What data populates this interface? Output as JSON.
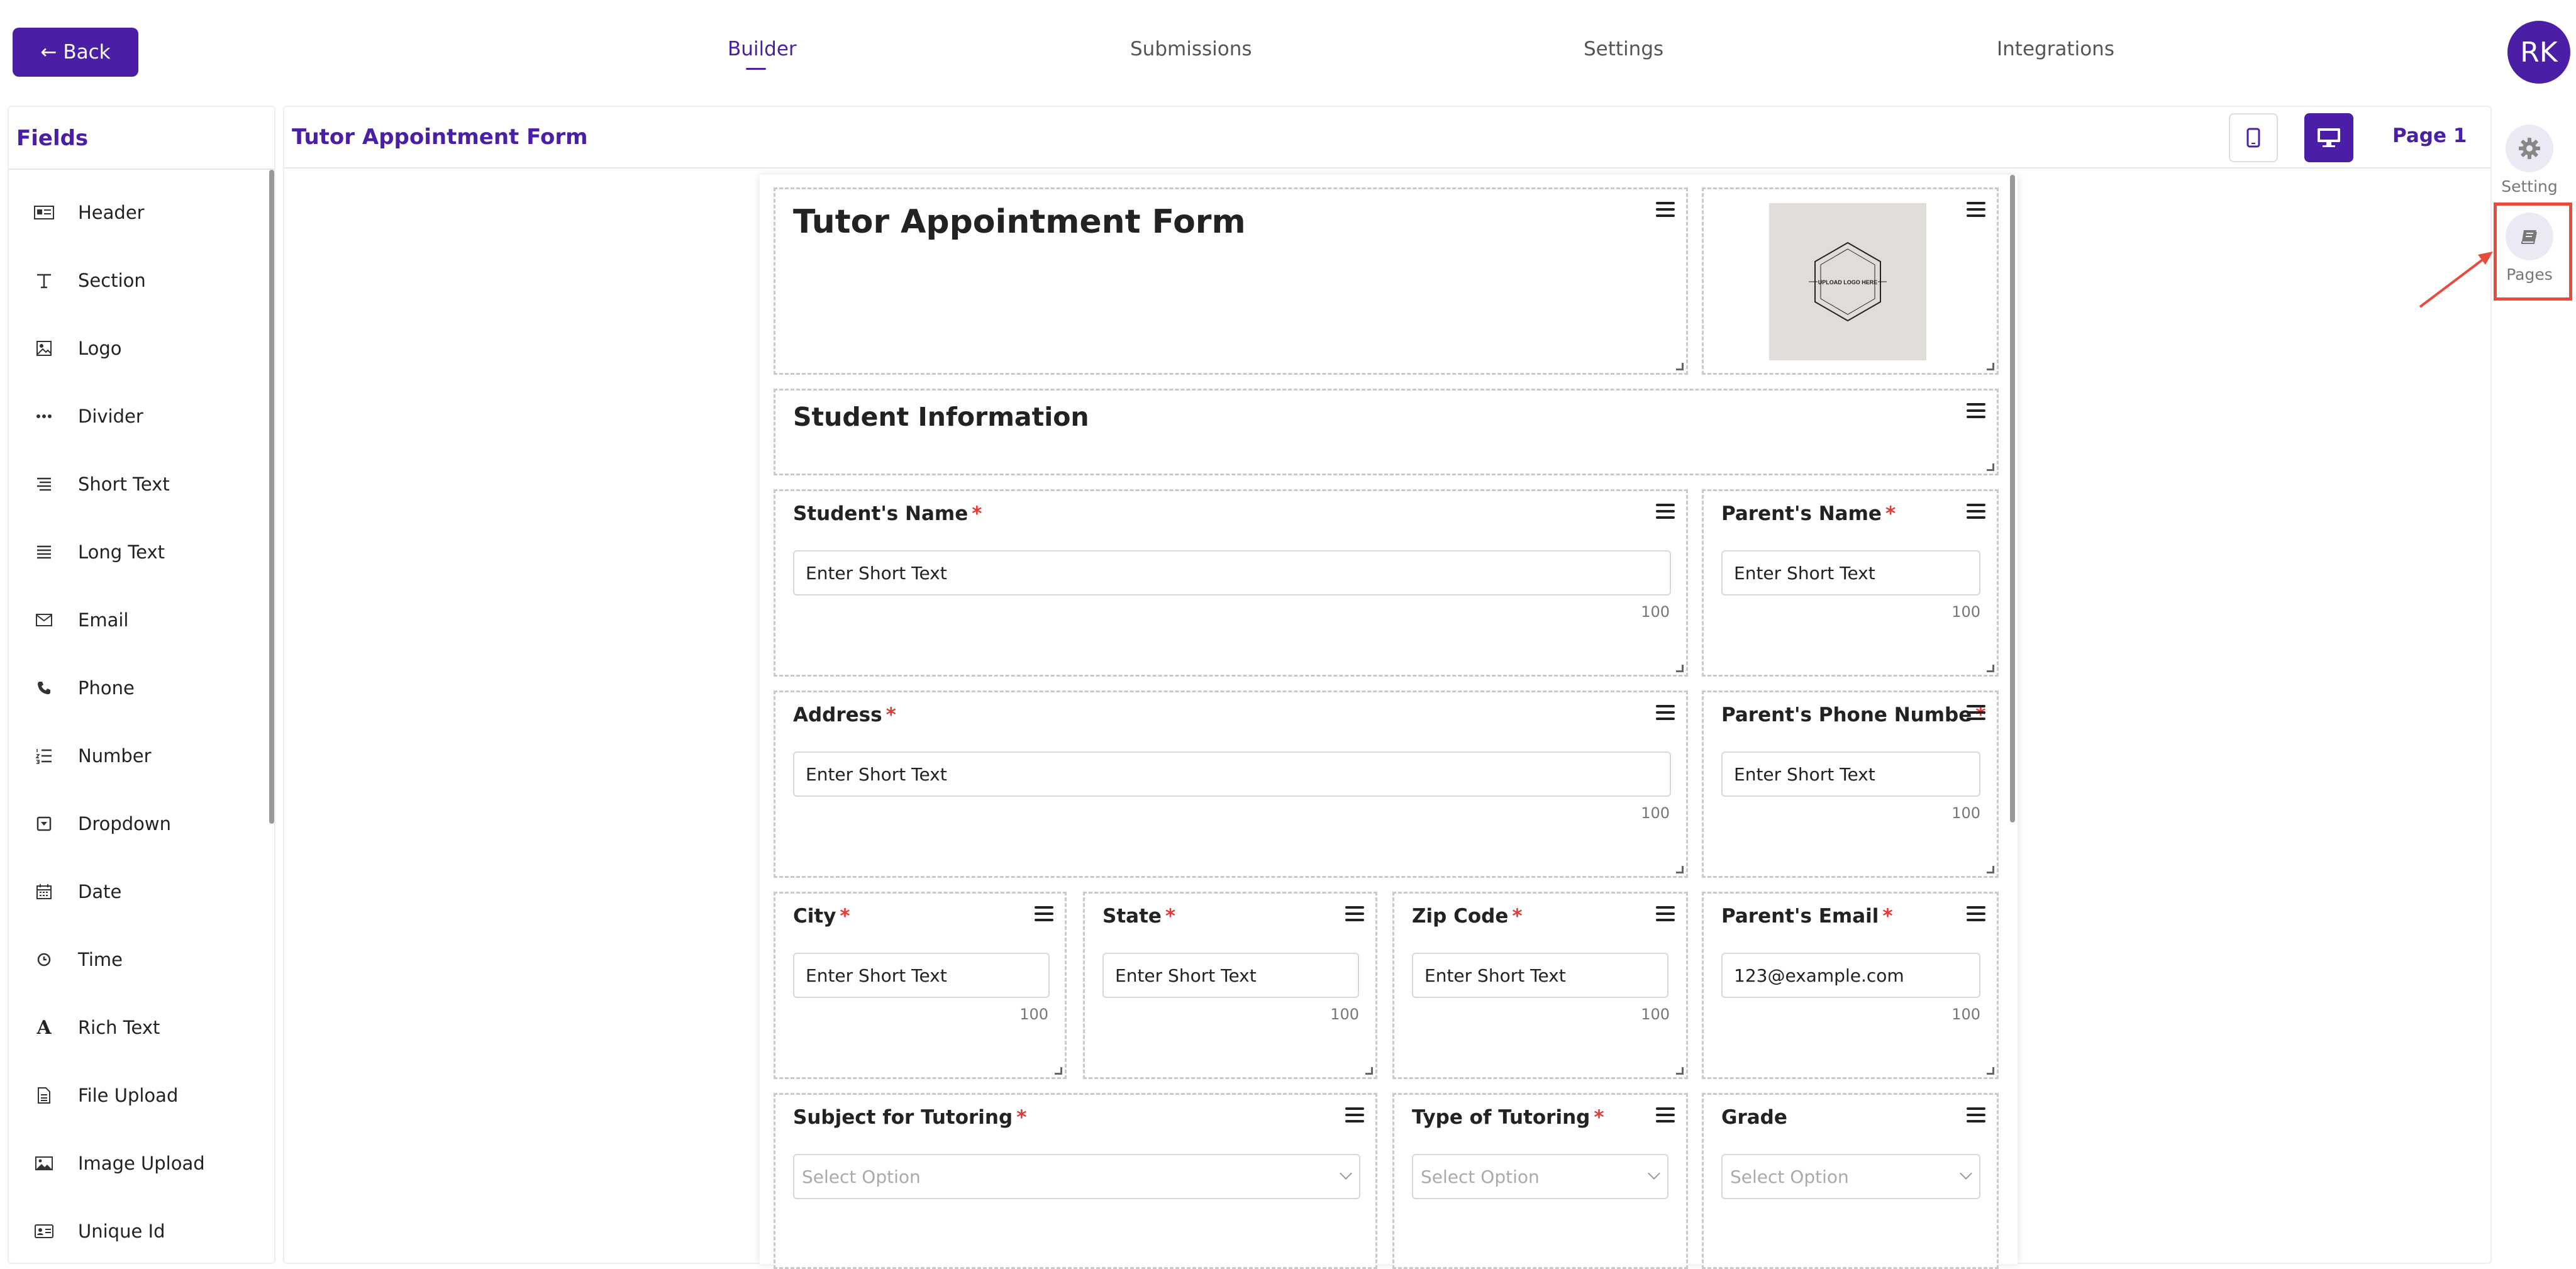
{
  "header": {
    "back_label": "Back",
    "tabs": [
      "Builder",
      "Submissions",
      "Settings",
      "Integrations"
    ],
    "active_tab": "Builder",
    "avatar_initials": "RK",
    "accent_color": "#4a1fa6"
  },
  "fields_panel": {
    "title": "Fields",
    "items": [
      {
        "label": "Header",
        "icon": "header-icon"
      },
      {
        "label": "Section",
        "icon": "text-icon"
      },
      {
        "label": "Logo",
        "icon": "image-icon"
      },
      {
        "label": "Divider",
        "icon": "dots-icon"
      },
      {
        "label": "Short Text",
        "icon": "short-text-icon"
      },
      {
        "label": "Long Text",
        "icon": "long-text-icon"
      },
      {
        "label": "Email",
        "icon": "envelope-icon"
      },
      {
        "label": "Phone",
        "icon": "phone-icon"
      },
      {
        "label": "Number",
        "icon": "numbered-list-icon"
      },
      {
        "label": "Dropdown",
        "icon": "dropdown-icon"
      },
      {
        "label": "Date",
        "icon": "calendar-icon"
      },
      {
        "label": "Time",
        "icon": "clock-icon"
      },
      {
        "label": "Rich Text",
        "icon": "rich-text-icon"
      },
      {
        "label": "File Upload",
        "icon": "file-icon"
      },
      {
        "label": "Image Upload",
        "icon": "image-upload-icon"
      },
      {
        "label": "Unique Id",
        "icon": "id-card-icon"
      }
    ]
  },
  "main": {
    "form_title": "Tutor Appointment Form",
    "page_label": "Page 1"
  },
  "form": {
    "title": "Tutor Appointment Form",
    "logo_text": "UPLOAD LOGO HERE",
    "section_title": "Student Information",
    "fields": {
      "student_name": {
        "label": "Student's Name",
        "placeholder": "Enter Short Text",
        "max": "100"
      },
      "parent_name": {
        "label": "Parent's Name",
        "placeholder": "Enter Short Text",
        "max": "100"
      },
      "address": {
        "label": "Address",
        "placeholder": "Enter Short Text",
        "max": "100"
      },
      "parent_phone": {
        "label": "Parent's Phone Numbe",
        "placeholder": "Enter Short Text",
        "max": "100"
      },
      "city": {
        "label": "City",
        "placeholder": "Enter Short Text",
        "max": "100"
      },
      "state": {
        "label": "State",
        "placeholder": "Enter Short Text",
        "max": "100"
      },
      "zip": {
        "label": "Zip Code",
        "placeholder": "Enter Short Text",
        "max": "100"
      },
      "parent_email": {
        "label": "Parent's Email",
        "placeholder": "123@example.com",
        "max": "100"
      },
      "subject": {
        "label": "Subject for Tutoring",
        "placeholder": "Select Option"
      },
      "tutoring_type": {
        "label": "Type of Tutoring",
        "placeholder": "Select Option"
      },
      "grade": {
        "label": "Grade",
        "placeholder": "Select Option"
      }
    },
    "required_mark": "*"
  },
  "right_sidebar": {
    "setting_label": "Setting",
    "pages_label": "Pages"
  }
}
